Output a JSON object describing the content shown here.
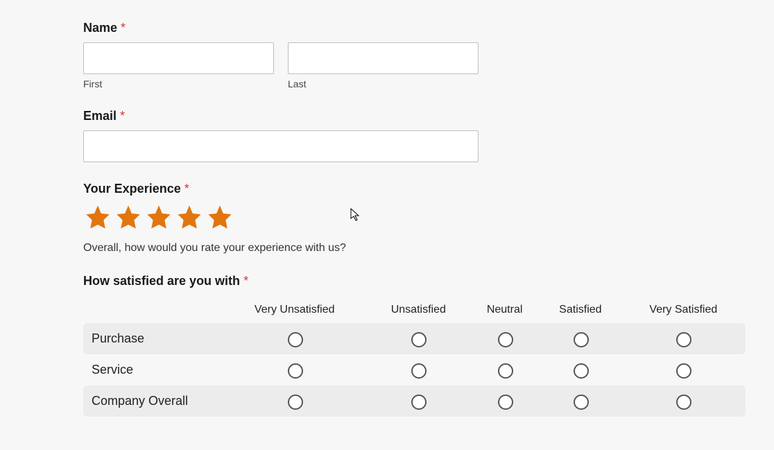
{
  "name": {
    "label": "Name",
    "required": "*",
    "first_sub": "First",
    "last_sub": "Last",
    "first_value": "",
    "last_value": ""
  },
  "email": {
    "label": "Email",
    "required": "*",
    "value": ""
  },
  "experience": {
    "label": "Your Experience",
    "required": "*",
    "help": "Overall, how would you rate your experience with us?",
    "star_color": "#e2750e",
    "rating": 5
  },
  "satisfaction": {
    "label": "How satisfied are you with",
    "required": "*",
    "columns": [
      "Very Unsatisfied",
      "Unsatisfied",
      "Neutral",
      "Satisfied",
      "Very Satisfied"
    ],
    "rows": [
      "Purchase",
      "Service",
      "Company Overall"
    ]
  }
}
